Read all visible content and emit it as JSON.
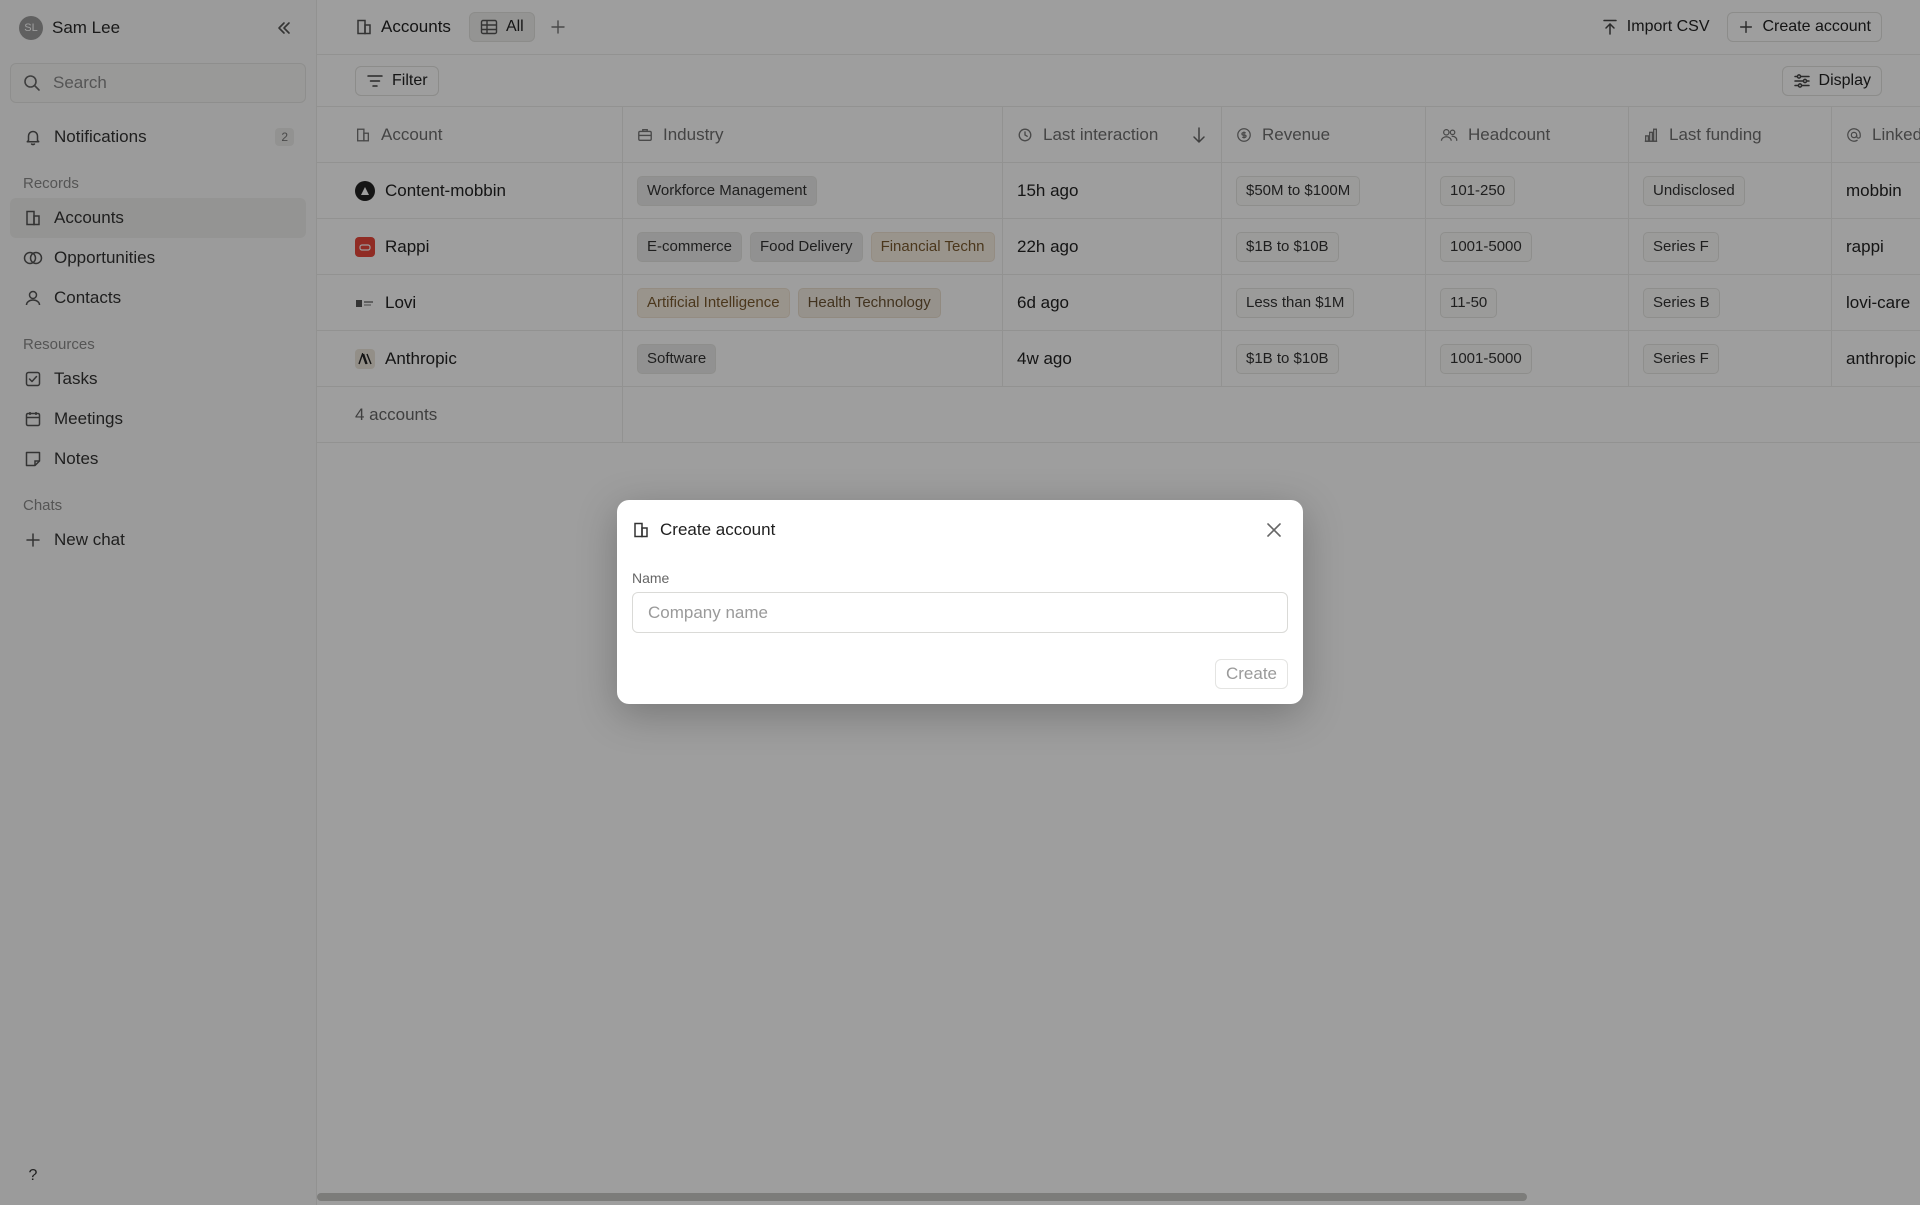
{
  "sidebar": {
    "user": {
      "initials": "SL",
      "name": "Sam Lee"
    },
    "search_placeholder": "Search",
    "notifications": {
      "label": "Notifications",
      "count": "2"
    },
    "records_label": "Records",
    "records": [
      {
        "label": "Accounts",
        "icon": "building-icon"
      },
      {
        "label": "Opportunities",
        "icon": "rings-icon"
      },
      {
        "label": "Contacts",
        "icon": "person-icon"
      }
    ],
    "resources_label": "Resources",
    "resources": [
      {
        "label": "Tasks",
        "icon": "checkbox-icon"
      },
      {
        "label": "Meetings",
        "icon": "calendar-icon"
      },
      {
        "label": "Notes",
        "icon": "note-icon"
      }
    ],
    "chats_label": "Chats",
    "new_chat": "New chat",
    "help": "?"
  },
  "topbar": {
    "breadcrumb": "Accounts",
    "view": "All",
    "import_csv": "Import CSV",
    "create_account": "Create account"
  },
  "filterbar": {
    "filter": "Filter",
    "display": "Display"
  },
  "table": {
    "columns": [
      "Account",
      "Industry",
      "Last interaction",
      "Revenue",
      "Headcount",
      "Last funding",
      "Linked"
    ],
    "rows": [
      {
        "account": "Content-mobbin",
        "industries": [
          "Workforce Management"
        ],
        "last": "15h ago",
        "revenue": "$50M to $100M",
        "headcount": "101-250",
        "funding": "Undisclosed",
        "linkedin": "mobbin"
      },
      {
        "account": "Rappi",
        "industries": [
          "E-commerce",
          "Food Delivery",
          "Financial Techn"
        ],
        "last": "22h ago",
        "revenue": "$1B to $10B",
        "headcount": "1001-5000",
        "funding": "Series F",
        "linkedin": "rappi"
      },
      {
        "account": "Lovi",
        "industries": [
          "Artificial Intelligence",
          "Health Technology"
        ],
        "last": "6d ago",
        "revenue": "Less than $1M",
        "headcount": "11-50",
        "funding": "Series B",
        "linkedin": "lovi-care"
      },
      {
        "account": "Anthropic",
        "industries": [
          "Software"
        ],
        "last": "4w ago",
        "revenue": "$1B to $10B",
        "headcount": "1001-5000",
        "funding": "Series F",
        "linkedin": "anthropic"
      }
    ],
    "footer": "4 accounts"
  },
  "modal": {
    "title": "Create account",
    "field_label": "Name",
    "field_value": "",
    "field_placeholder": "Company name",
    "submit": "Create"
  },
  "colors": {
    "overlay": "#000000",
    "accent_rappi": "#e8473a",
    "logo_dark": "#222222"
  }
}
